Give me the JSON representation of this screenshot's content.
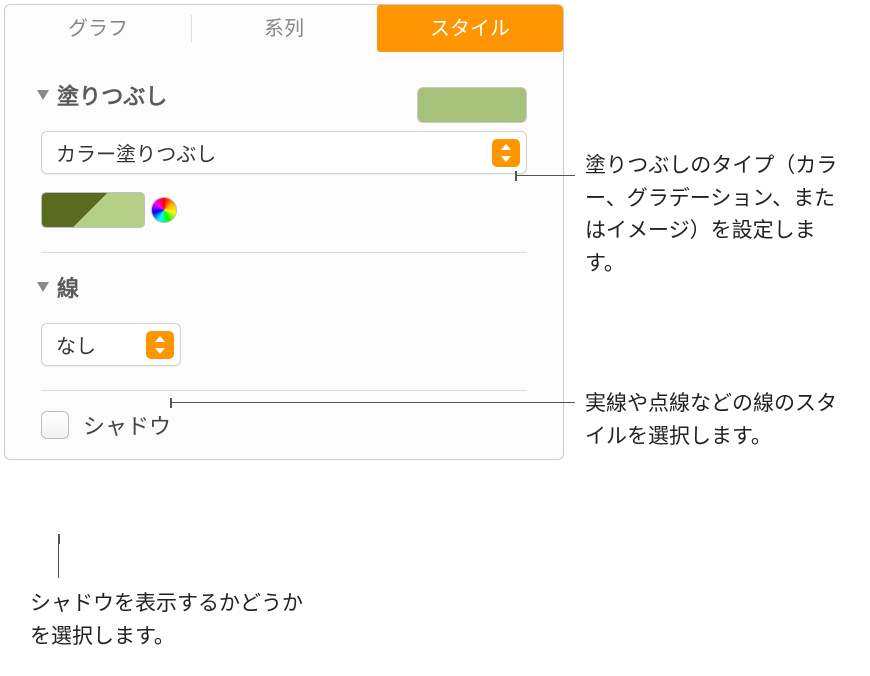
{
  "tabs": {
    "chart": "グラフ",
    "series": "系列",
    "style": "スタイル"
  },
  "fill": {
    "title": "塗りつぶし",
    "type_label": "カラー塗りつぶし",
    "swatch_color": "#a6c17a"
  },
  "line": {
    "title": "線",
    "value": "なし"
  },
  "shadow": {
    "label": "シャドウ",
    "checked": false
  },
  "callouts": {
    "fill": "塗りつぶしのタイプ（カラー、グラデーション、またはイメージ）を設定します。",
    "line": "実線や点線などの線のスタイルを選択します。",
    "shadow": "シャドウを表示するかどうかを選択します。"
  }
}
